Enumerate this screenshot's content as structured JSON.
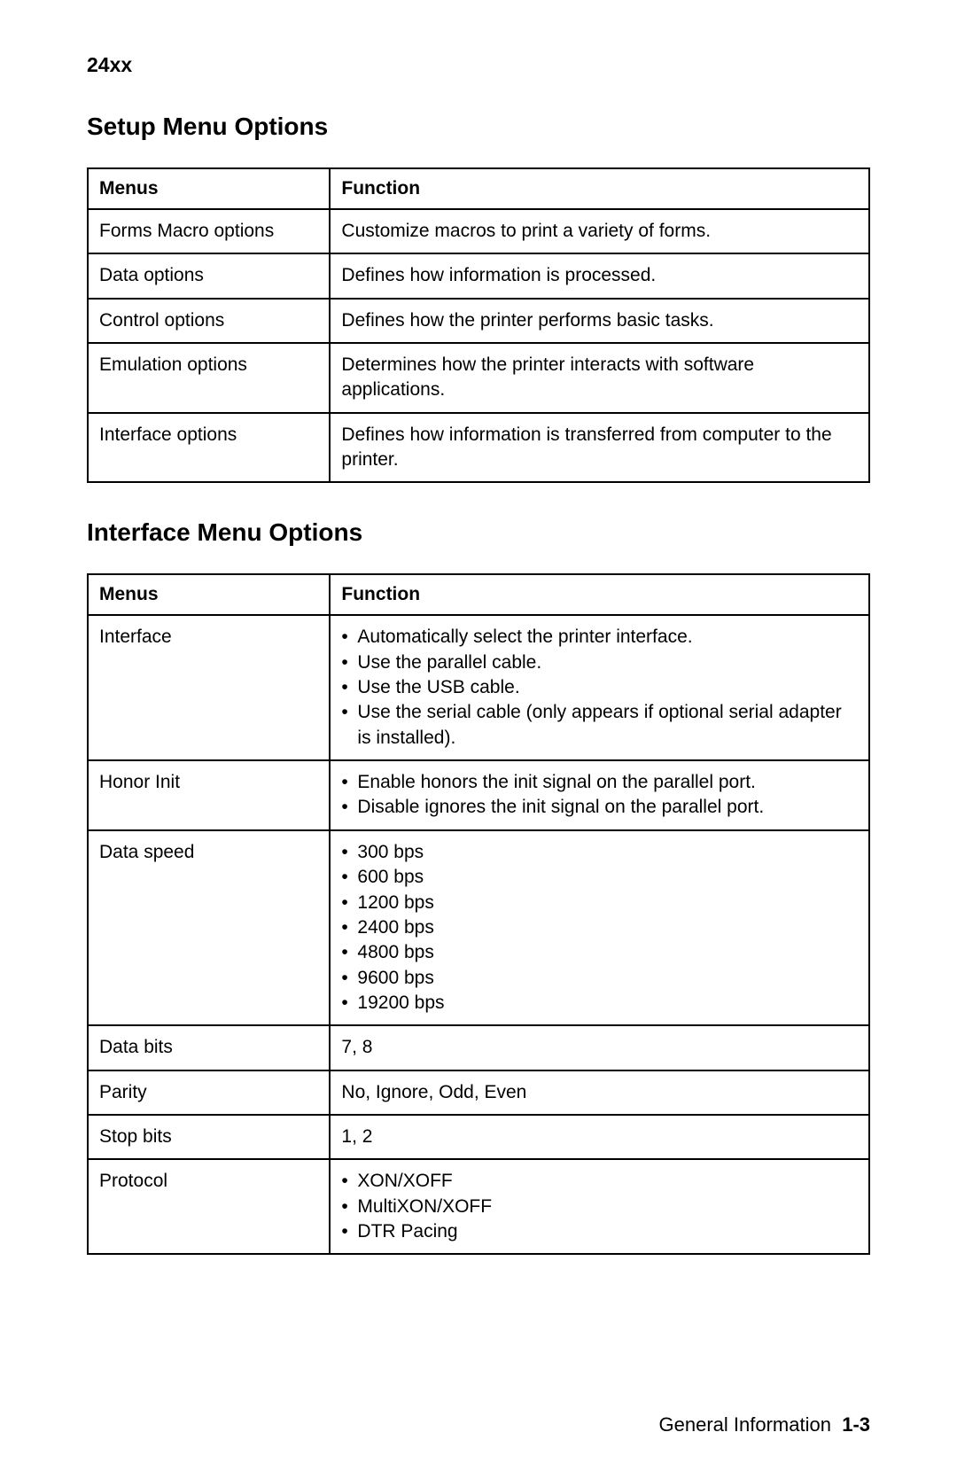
{
  "header": {
    "model": "24xx"
  },
  "sections": {
    "setup": {
      "title": "Setup Menu Options",
      "columns": {
        "menus": "Menus",
        "function": "Function"
      },
      "rows": [
        {
          "menu": "Forms Macro options",
          "function": "Customize macros to print a variety of forms."
        },
        {
          "menu": "Data options",
          "function": "Defines how information is processed."
        },
        {
          "menu": "Control options",
          "function": "Defines how the printer performs basic tasks."
        },
        {
          "menu": "Emulation options",
          "function": "Determines how the printer interacts with software applications."
        },
        {
          "menu": "Interface options",
          "function": "Defines how information is transferred from computer to the printer."
        }
      ]
    },
    "interface": {
      "title": "Interface Menu Options",
      "columns": {
        "menus": "Menus",
        "function": "Function"
      },
      "rows": [
        {
          "menu": "Interface",
          "bullets": [
            "Automatically select the printer interface.",
            "Use the parallel cable.",
            "Use the USB cable.",
            "Use the serial cable (only appears if optional serial adapter is installed)."
          ]
        },
        {
          "menu": "Honor Init",
          "bullets": [
            "Enable honors the init signal on the parallel port.",
            "Disable ignores the init signal on the parallel port."
          ]
        },
        {
          "menu": "Data speed",
          "bullets": [
            "300 bps",
            "600 bps",
            "1200 bps",
            "2400 bps",
            "4800 bps",
            "9600 bps",
            "19200 bps"
          ]
        },
        {
          "menu": "Data bits",
          "function": "7, 8"
        },
        {
          "menu": "Parity",
          "function": "No, Ignore, Odd, Even"
        },
        {
          "menu": "Stop bits",
          "function": "1, 2"
        },
        {
          "menu": "Protocol",
          "bullets": [
            "XON/XOFF",
            "MultiXON/XOFF",
            "DTR Pacing"
          ]
        }
      ]
    }
  },
  "footer": {
    "section": "General Information",
    "page": "1-3"
  }
}
